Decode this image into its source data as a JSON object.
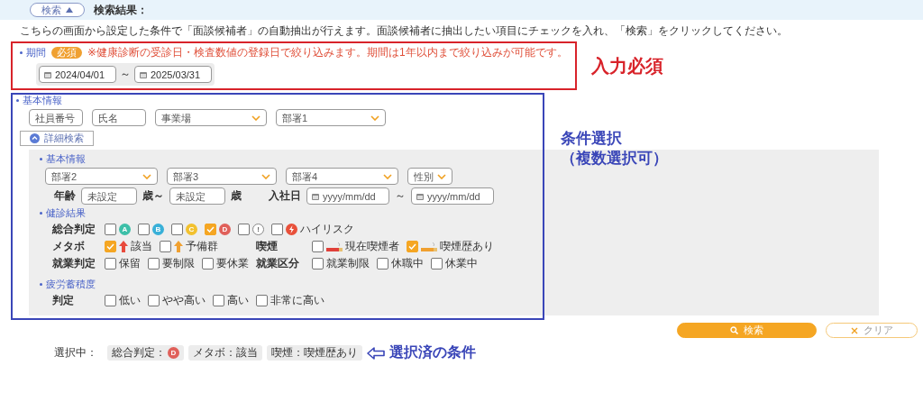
{
  "header": {
    "toggle_label": "検索",
    "result_label": "検索結果："
  },
  "description": "こちらの画面から設定した条件で「面談候補者」の自動抽出が行えます。面談候補者に抽出したい項目にチェックを入れ、「検索」をクリックしてください。",
  "period": {
    "label": "期間",
    "required_badge": "必須",
    "note": "※健康診断の受診日・検査数値の登録日で絞り込みます。期間は1年以内まで絞り込みが可能です。",
    "start": {
      "kind": "date",
      "value": "2024/04/01"
    },
    "separator": "～",
    "end": {
      "kind": "date",
      "value": "2025/03/31"
    }
  },
  "required_annotation": "入力必須",
  "basic": {
    "label": "基本情報",
    "fields": [
      {
        "kind": "text",
        "placeholder": "社員番号"
      },
      {
        "kind": "text",
        "placeholder": "氏名"
      },
      {
        "kind": "select",
        "placeholder": "事業場"
      },
      {
        "kind": "select",
        "placeholder": "部署1"
      }
    ]
  },
  "detail_button": {
    "label": "詳細検索",
    "expanded": true
  },
  "detail": {
    "basic_label": "基本情報",
    "selects": [
      {
        "kind": "select",
        "placeholder": "部署2"
      },
      {
        "kind": "select",
        "placeholder": "部署3"
      },
      {
        "kind": "select",
        "placeholder": "部署4"
      },
      {
        "kind": "select",
        "placeholder": "性別"
      }
    ],
    "age": {
      "label": "年齢",
      "from": {
        "kind": "text",
        "placeholder": "未設定"
      },
      "from_unit": "歳～",
      "to": {
        "kind": "text",
        "placeholder": "未設定"
      },
      "to_unit": "歳"
    },
    "hire": {
      "label": "入社日",
      "from": {
        "kind": "date",
        "placeholder": "yyyy/mm/dd"
      },
      "separator": "～",
      "to": {
        "kind": "date",
        "placeholder": "yyyy/mm/dd"
      }
    },
    "health": {
      "label": "健診結果",
      "rows": [
        {
          "groups": [
            {
              "label": "総合判定",
              "items": [
                {
                  "kind": "letter",
                  "label": "A",
                  "color": "#3dbfa8",
                  "checked": false
                },
                {
                  "kind": "letter",
                  "label": "B",
                  "color": "#39b0d8",
                  "checked": false
                },
                {
                  "kind": "letter",
                  "label": "C",
                  "color": "#f2c12e",
                  "checked": false
                },
                {
                  "kind": "letter",
                  "label": "D",
                  "color": "#e0605a",
                  "checked": true
                },
                {
                  "kind": "mark",
                  "label": "!",
                  "checked": false
                },
                {
                  "kind": "alert",
                  "label": "ハイリスク",
                  "color": "#e8503a",
                  "checked": false
                }
              ]
            }
          ]
        },
        {
          "groups": [
            {
              "label": "メタボ",
              "items": [
                {
                  "kind": "arrow",
                  "label": "該当",
                  "color": "#e84a3c",
                  "checked": true
                },
                {
                  "kind": "arrow",
                  "label": "予備群",
                  "color": "#f0a030",
                  "checked": false
                }
              ]
            },
            {
              "label": "喫煙",
              "items": [
                {
                  "kind": "cigarette",
                  "label": "現在喫煙者",
                  "color": "#e0403a",
                  "checked": false
                },
                {
                  "kind": "cigarette",
                  "label": "喫煙歴あり",
                  "color": "#f0a030",
                  "checked": true
                }
              ]
            }
          ]
        },
        {
          "groups": [
            {
              "label": "就業判定",
              "items": [
                {
                  "kind": "plain",
                  "label": "保留",
                  "checked": false
                },
                {
                  "kind": "plain",
                  "label": "要制限",
                  "checked": false
                },
                {
                  "kind": "plain",
                  "label": "要休業",
                  "checked": false
                }
              ]
            },
            {
              "label": "就業区分",
              "items": [
                {
                  "kind": "plain",
                  "label": "就業制限",
                  "checked": false
                },
                {
                  "kind": "plain",
                  "label": "休職中",
                  "checked": false
                },
                {
                  "kind": "plain",
                  "label": "休業中",
                  "checked": false
                }
              ]
            }
          ]
        }
      ]
    },
    "fatigue": {
      "label": "疲労蓄積度",
      "rows": [
        {
          "groups": [
            {
              "label": "判定",
              "items": [
                {
                  "kind": "plain",
                  "label": "低い",
                  "checked": false
                },
                {
                  "kind": "plain",
                  "label": "やや高い",
                  "checked": false
                },
                {
                  "kind": "plain",
                  "label": "高い",
                  "checked": false
                },
                {
                  "kind": "plain",
                  "label": "非常に高い",
                  "checked": false
                }
              ]
            }
          ]
        }
      ]
    }
  },
  "condition_annotation": [
    "条件選択",
    "（複数選択可）"
  ],
  "actions": [
    {
      "kind": "primary",
      "label": "検索"
    },
    {
      "kind": "secondary",
      "label": "クリア"
    }
  ],
  "selected": {
    "label": "選択中：",
    "chips": [
      {
        "label": "総合判定：",
        "badge": {
          "text": "D",
          "color": "#e0605a"
        }
      },
      {
        "label": "メタボ：該当"
      },
      {
        "label": "喫煙：喫煙歴あり"
      }
    ]
  },
  "selected_annotation": "選択済の条件"
}
